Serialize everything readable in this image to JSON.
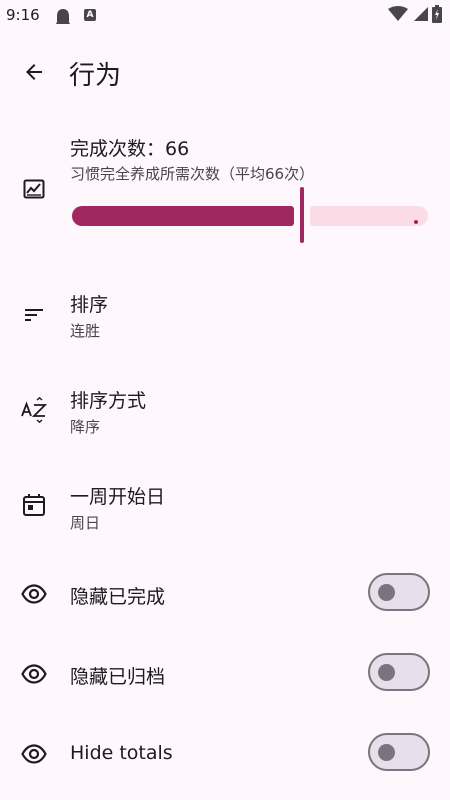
{
  "status_bar": {
    "time": "9:16",
    "notif_letter": "A",
    "icons": [
      "ghost-icon",
      "a-badge-icon",
      "wifi-icon",
      "signal-icon",
      "battery-icon"
    ]
  },
  "app_bar": {
    "title": "行为",
    "back_icon": "arrow-back-icon"
  },
  "completion": {
    "title": "完成次数：66",
    "subtitle": "习惯完全养成所需次数（平均66次）",
    "icon": "chart-icon",
    "slider_fraction": 0.64
  },
  "settings": [
    {
      "title": "排序",
      "subtitle": "连胜",
      "icon": "sort-lines-icon"
    },
    {
      "title": "排序方式",
      "subtitle": "降序",
      "icon": "sort-az-icon"
    },
    {
      "title": "一周开始日",
      "subtitle": "周日",
      "icon": "calendar-icon"
    }
  ],
  "toggles": [
    {
      "label": "隐藏已完成",
      "icon": "eye-icon",
      "checked": false
    },
    {
      "label": "隐藏已归档",
      "icon": "eye-icon",
      "checked": false
    },
    {
      "label": "Hide totals",
      "icon": "eye-icon",
      "checked": false
    }
  ],
  "colors": {
    "background": "#FEF7FB",
    "primary": "#A0275F",
    "slider_track": "#FBDBE6",
    "on_surface": "#1D1B20",
    "on_surface_variant": "#49454F",
    "outline": "#79747E"
  }
}
